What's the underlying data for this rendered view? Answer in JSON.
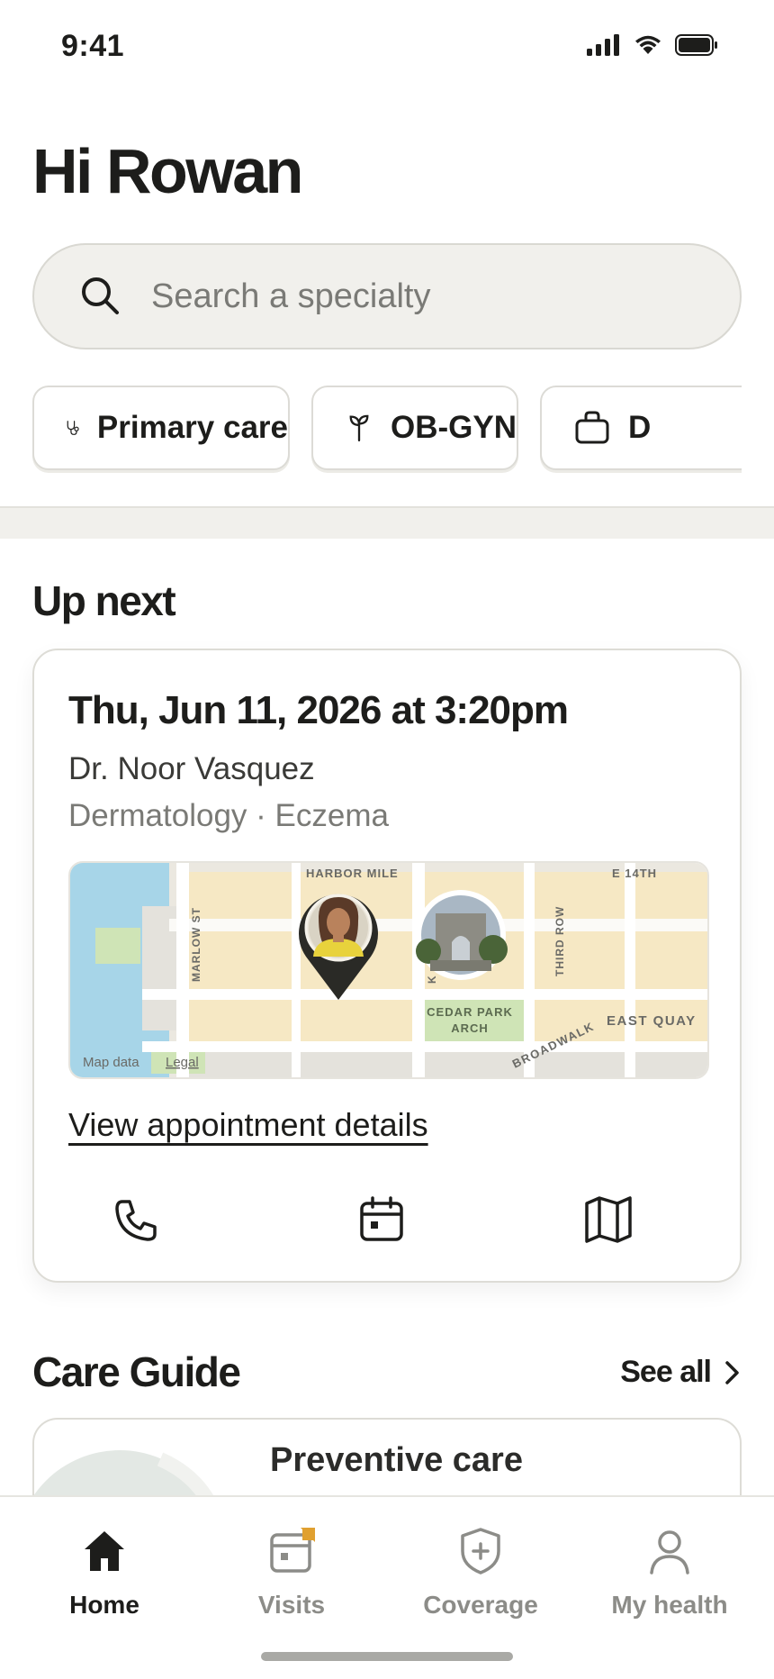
{
  "status": {
    "time": "9:41"
  },
  "greeting": "Hi Rowan",
  "search": {
    "placeholder": "Search a specialty",
    "value": ""
  },
  "chips": [
    {
      "label": "Primary care",
      "icon": "stethoscope-icon"
    },
    {
      "label": "OB-GYN",
      "icon": "sprout-icon"
    },
    {
      "label": "D",
      "icon": "briefcase-icon"
    }
  ],
  "up_next": {
    "title": "Up next",
    "appointment": {
      "datetime": "Thu, Jun 11, 2026 at 3:20pm",
      "doctor": "Dr. Noor Vasquez",
      "specialty": "Dermatology · Eczema",
      "link_label": "View appointment details",
      "map": {
        "streets": [
          "HARBOR MILE",
          "E 14TH",
          "MARLOW ST",
          "THIRD ROW",
          "BROADWALK",
          "EAST QUAY",
          "K"
        ],
        "landmark": [
          "CEDAR PARK",
          "ARCH"
        ],
        "attribution": "Map data",
        "legal": "Legal"
      },
      "actions": [
        "phone-icon",
        "calendar-icon",
        "map-icon"
      ]
    }
  },
  "care_guide": {
    "title": "Care Guide",
    "see_all": "See all",
    "card_title": "Preventive care"
  },
  "tabs": [
    {
      "label": "Home",
      "active": true
    },
    {
      "label": "Visits",
      "active": false,
      "badge_color": "#e0a030"
    },
    {
      "label": "Coverage",
      "active": false
    },
    {
      "label": "My health",
      "active": false
    }
  ],
  "colors": {
    "text": "#1d1d1b",
    "muted": "#7a7a76",
    "surface": "#f1f0ec",
    "map_block": "#f6e8c4",
    "map_water": "#a7d5e8",
    "map_park": "#cfe4b6",
    "badge": "#e0a030"
  }
}
